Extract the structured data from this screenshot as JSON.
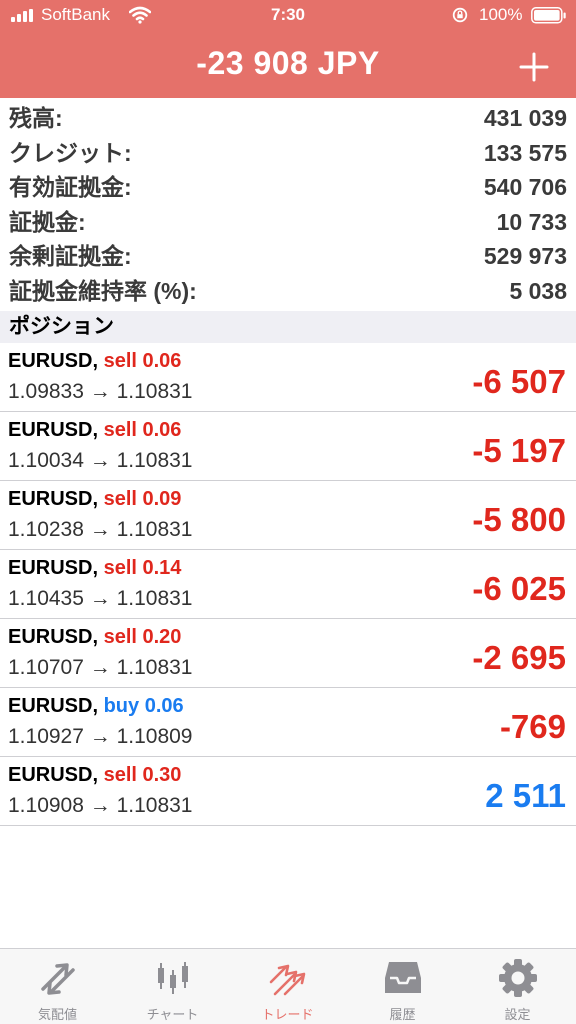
{
  "status_bar": {
    "carrier": "SoftBank",
    "time": "7:30",
    "battery": "100%"
  },
  "header": {
    "title": "-23 908 JPY",
    "add_icon": "plus-icon"
  },
  "summary": [
    {
      "label": "残高:",
      "value": "431 039"
    },
    {
      "label": "クレジット:",
      "value": "133 575"
    },
    {
      "label": "有効証拠金:",
      "value": "540 706"
    },
    {
      "label": "証拠金:",
      "value": "10 733"
    },
    {
      "label": "余剰証拠金:",
      "value": "529 973"
    },
    {
      "label": "証拠金維持率 (%):",
      "value": "5 038"
    }
  ],
  "positions_header": "ポジション",
  "positions": [
    {
      "symbol": "EURUSD,",
      "side": "sell 0.06",
      "prices": "1.09833 → 1.10831",
      "profit": "-6 507"
    },
    {
      "symbol": "EURUSD,",
      "side": "sell 0.06",
      "prices": "1.10034 → 1.10831",
      "profit": "-5 197"
    },
    {
      "symbol": "EURUSD,",
      "side": "sell 0.09",
      "prices": "1.10238 → 1.10831",
      "profit": "-5 800"
    },
    {
      "symbol": "EURUSD,",
      "side": "sell 0.14",
      "prices": "1.10435 → 1.10831",
      "profit": "-6 025"
    },
    {
      "symbol": "EURUSD,",
      "side": "sell 0.20",
      "prices": "1.10707 → 1.10831",
      "profit": "-2 695"
    },
    {
      "symbol": "EURUSD,",
      "side": "buy 0.06",
      "prices": "1.10927 → 1.10809",
      "profit": "-769"
    },
    {
      "symbol": "EURUSD,",
      "side": "sell 0.30",
      "prices": "1.10908 → 1.10831",
      "profit": "2 511"
    }
  ],
  "tabs": [
    {
      "label": "気配値",
      "icon": "quotes-icon"
    },
    {
      "label": "チャート",
      "icon": "chart-icon"
    },
    {
      "label": "トレード",
      "icon": "trade-icon",
      "active": true
    },
    {
      "label": "履歴",
      "icon": "history-icon"
    },
    {
      "label": "設定",
      "icon": "settings-icon"
    }
  ],
  "colors": {
    "header_bg": "#e5716a",
    "sell": "#e0271d",
    "buy": "#1a7cf0",
    "loss": "#e0271d",
    "profit": "#1a7cf0",
    "tab_active": "#e5716a",
    "tab_inactive": "#8e8e93"
  }
}
